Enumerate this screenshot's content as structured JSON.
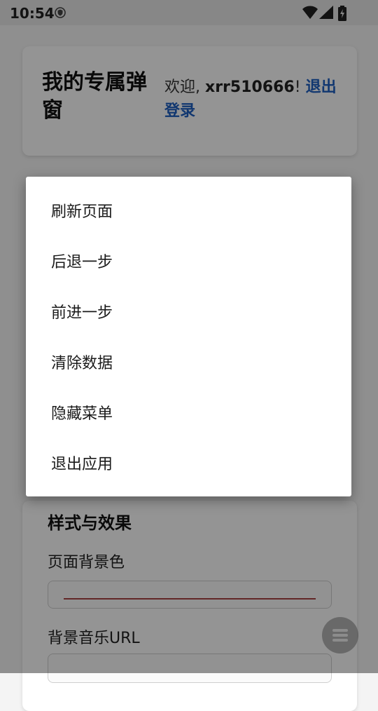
{
  "statusbar": {
    "time": "10:54",
    "icons": [
      "shield-icon",
      "wifi-icon",
      "signal-icon",
      "battery-charging-icon"
    ]
  },
  "header": {
    "title": "我的专属弹窗",
    "welcome_prefix": "欢迎, ",
    "username": "xrr510666",
    "welcome_suffix": "! ",
    "logout": "退出登录"
  },
  "style_section": {
    "title": "样式与效果",
    "bg_color_label": "页面背景色",
    "music_url_label": "背景音乐URL"
  },
  "menu": {
    "items": [
      "刷新页面",
      "后退一步",
      "前进一步",
      "清除数据",
      "隐藏菜单",
      "退出应用"
    ]
  },
  "colors": {
    "accent_link": "#1e5fc2",
    "scrim": "rgba(0,0,0,0.42)"
  }
}
